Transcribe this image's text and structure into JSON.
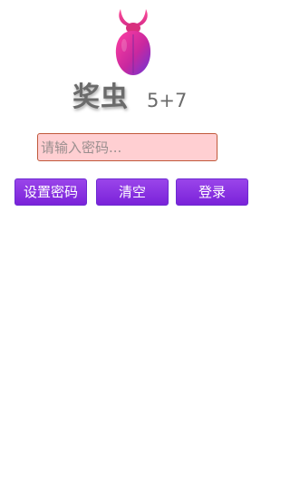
{
  "app": {
    "title": "奖虫",
    "version": "5+7",
    "logo_icon": "beetle-icon"
  },
  "login": {
    "password_placeholder": "请输入密码...",
    "password_value": "",
    "buttons": {
      "set_password": "设置密码",
      "clear": "清空",
      "login": "登录"
    }
  },
  "colors": {
    "button_purple": "#8a34e0",
    "input_bg": "#ffcfd2",
    "input_border": "#c0593b",
    "title_gray": "#6b6b6b"
  }
}
